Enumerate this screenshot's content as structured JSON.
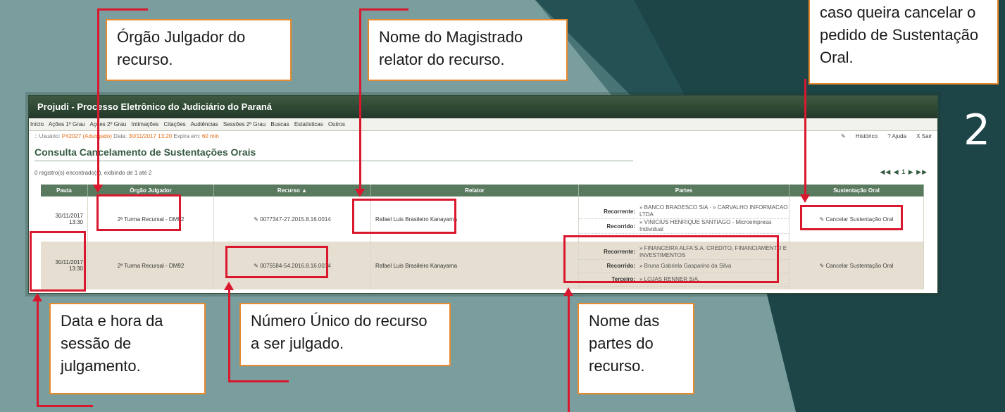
{
  "app": {
    "title": "Projudi - Processo Eletrônico do Judiciário do Paraná",
    "menu": [
      "Início",
      "Ações 1º Grau",
      "Ações 2º Grau",
      "Intimações",
      "Citações",
      "Audiências",
      "Sessões 2º Grau",
      "Buscas",
      "Estatísticas",
      "Outros"
    ],
    "user_prefix": ":: Usuário:",
    "user_name": "P42027 (Advogado)",
    "date_label": "Data:",
    "date_value": "30/11/2017 13:20",
    "expires_label": "Expira em:",
    "expires_value": "60 min",
    "historico": "Histórico",
    "ajuda": "? Ajuda",
    "sair": "X Sair"
  },
  "page": {
    "title": "Consulta Cancelamento de Sustentações Orais",
    "records": "0 registro(s) encontrado(s), exibindo de 1 até 2",
    "pager": "◀◀ ◀ 1 ▶ ▶▶"
  },
  "table": {
    "headers": [
      "Pauta",
      "Órgão Julgador",
      "Recurso ▲",
      "Relator",
      "Partes",
      "Sustentação Oral"
    ],
    "rows": [
      {
        "pauta_date": "30/11/2017",
        "pauta_time": "13:30",
        "orgao": "2ª Turma Recursal - DM92",
        "recurso": "0077347-27.2015.8.16.0014",
        "relator": "Rafael Luis Brasileiro Kanayama",
        "partes": [
          {
            "role": "Recorrente:",
            "names": "» BANCO BRADESCO S/A · » CARVALHO INFORMACAO LTDA"
          },
          {
            "role": "Recorrido:",
            "names": "» VINICIUS HENRIQUE SANTIAGO - Microempresa Individual"
          }
        ],
        "sustentacao": "Cancelar Sustentação Oral"
      },
      {
        "pauta_date": "30/11/2017",
        "pauta_time": "13:30",
        "orgao": "2ª Turma Recursal - DM92",
        "recurso": "0075584-54.2016.8.16.0014",
        "relator": "Rafael Luis Brasileiro Kanayama",
        "partes": [
          {
            "role": "Recorrente:",
            "names": "» FINANCEIRA ALFA S.A. CREDITO, FINANCIAMENTO E INVESTIMENTOS"
          },
          {
            "role": "Recorrido:",
            "names": "» Bruna Gabriela Gasparino da Silva"
          },
          {
            "role": "Terceiro:",
            "names": "» LOJAS RENNER S/A."
          }
        ],
        "sustentacao": "Cancelar Sustentação Oral"
      }
    ]
  },
  "annotations": {
    "orgao": "Órgão Julgador do recurso.",
    "relator": "Nome do Magistrado relator do recurso.",
    "cancelar": "caso queira cancelar o pedido de Sustentação Oral.",
    "data": "Data e hora da sessão de julgamento.",
    "numero": "Número Único do recurso a ser julgado.",
    "partes": "Nome das partes do recurso.",
    "step": "2"
  },
  "colors": {
    "annotation_red": "#d9182e",
    "callout_border": "#e88a2e",
    "header_green": "#5a7a60",
    "background_teal": "#7a9e9e",
    "background_dark": "#1d4548"
  }
}
